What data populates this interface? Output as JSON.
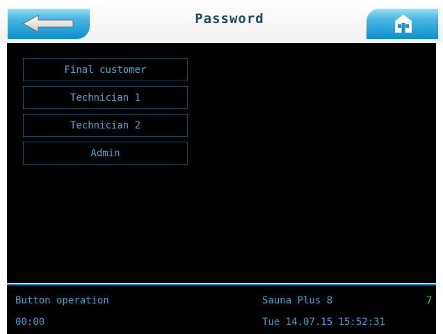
{
  "header": {
    "title": "Password",
    "back_icon": "back-arrow-icon",
    "home_icon": "home-icon",
    "accent_color": "#1c92cf"
  },
  "menu": {
    "items": [
      {
        "label": "Final customer"
      },
      {
        "label": "Technician 1"
      },
      {
        "label": "Technician 2"
      },
      {
        "label": "Admin"
      }
    ]
  },
  "status_bar": {
    "mode": "Button operation",
    "timer": "00:00",
    "product": "Sauna Plus 8",
    "product_index": "7",
    "datetime": "Tue 14.07.15 15:52:31"
  }
}
